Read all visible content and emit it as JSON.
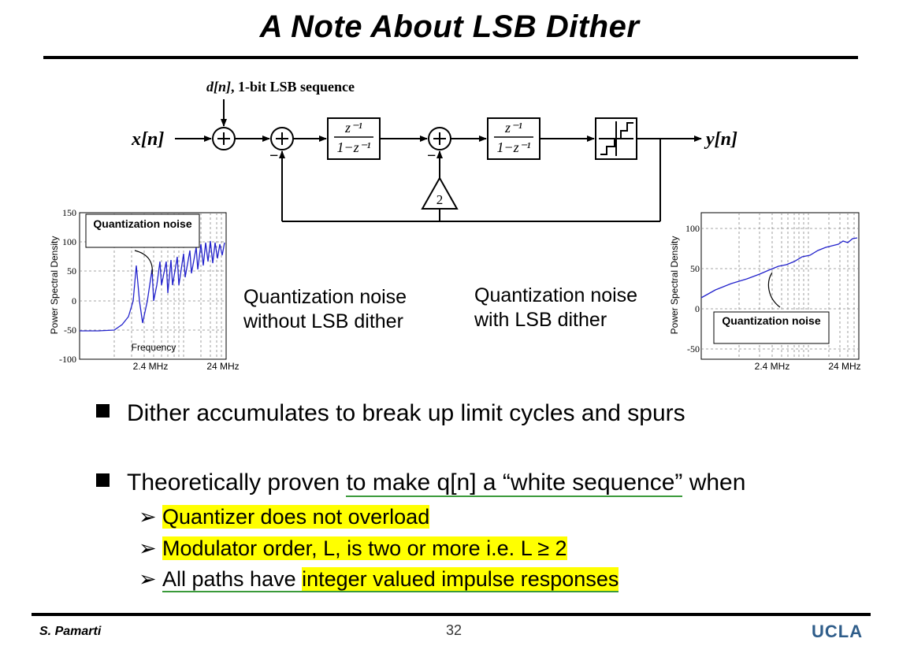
{
  "slide": {
    "title": "A Note About LSB Dither",
    "footer_author": "S. Pamarti",
    "page_number": "32",
    "logo": "UCLA"
  },
  "diagram": {
    "dither_label_var": "d[n]",
    "dither_label_text": ", 1-bit LSB sequence",
    "input_label": "x[n]",
    "output_label": "y[n]",
    "delay_num": "z⁻¹",
    "delay_den": "1−z⁻¹",
    "gain": "2",
    "minus": "−"
  },
  "captions": {
    "left_line1": "Quantization noise",
    "left_line2": "without LSB dither",
    "right_line1": "Quantization noise",
    "right_line2": "with LSB dither"
  },
  "bullets": {
    "b1": "Dither accumulates to break up limit cycles and spurs",
    "b2_pre": "Theoretically proven ",
    "b2_ul": "to make q[n] a “white sequence”",
    "b2_post": " when",
    "s1": "Quantizer does not overload",
    "s2": "Modulator order, L, is two or more i.e. L ≥ 2",
    "s3_pre": "All paths have ",
    "s3_hl": "integer valued impulse responses"
  },
  "chart_data": [
    {
      "type": "line",
      "ylabel": "Power Spectral Density",
      "xlabel": "Frequency",
      "yticks": [
        "150",
        "100",
        "50",
        "0",
        "-50",
        "-100"
      ],
      "ylim": [
        -100,
        150
      ],
      "xticks": [
        "2.4 MHz",
        "24 MHz"
      ],
      "annotation": "Quantization noise",
      "grid": true
    },
    {
      "type": "line",
      "ylabel": "Power Spectral Density",
      "yticks": [
        "100",
        "50",
        "0",
        "-50"
      ],
      "ylim": [
        -50,
        100
      ],
      "xticks": [
        "2.4 MHz",
        "24 MHz"
      ],
      "annotation": "Quantization noise",
      "grid": true
    }
  ],
  "colors": {
    "trace": "#2222cc",
    "highlight": "#ffff00",
    "underline": "#3a9a3a",
    "logo": "#2f5d8a"
  }
}
